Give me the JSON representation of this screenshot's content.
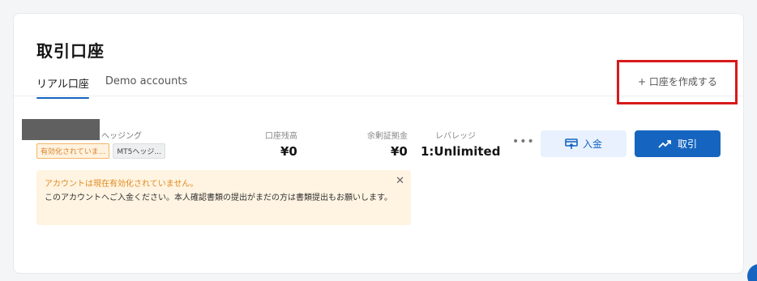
{
  "page": {
    "title": "取引口座"
  },
  "tabs": [
    {
      "label": "リアル口座",
      "active": true
    },
    {
      "label": "Demo accounts",
      "active": false
    }
  ],
  "create_account": {
    "label": "+ 口座を作成する"
  },
  "account": {
    "type_label": "ヘッジング",
    "badges": [
      "有効化されていま...",
      "MT5ヘッジ..."
    ],
    "balance_label": "口座残高",
    "balance_value": "¥0",
    "free_margin_label": "余剰証拠金",
    "free_margin_value": "¥0",
    "leverage_label": "レバレッジ",
    "leverage_value": "1:Unlimited",
    "more_label": "•••"
  },
  "actions": {
    "deposit_label": "入金",
    "trade_label": "取引"
  },
  "alert": {
    "title": "アカウントは現在有効化されていません。",
    "body": "このアカウントへご入金ください。本人確認書類の提出がまだの方は書類提出もお願いします。",
    "close": "✕"
  },
  "colors": {
    "accent": "#1565c0",
    "warning": "#e08a1e",
    "highlight": "#d71a1a"
  }
}
